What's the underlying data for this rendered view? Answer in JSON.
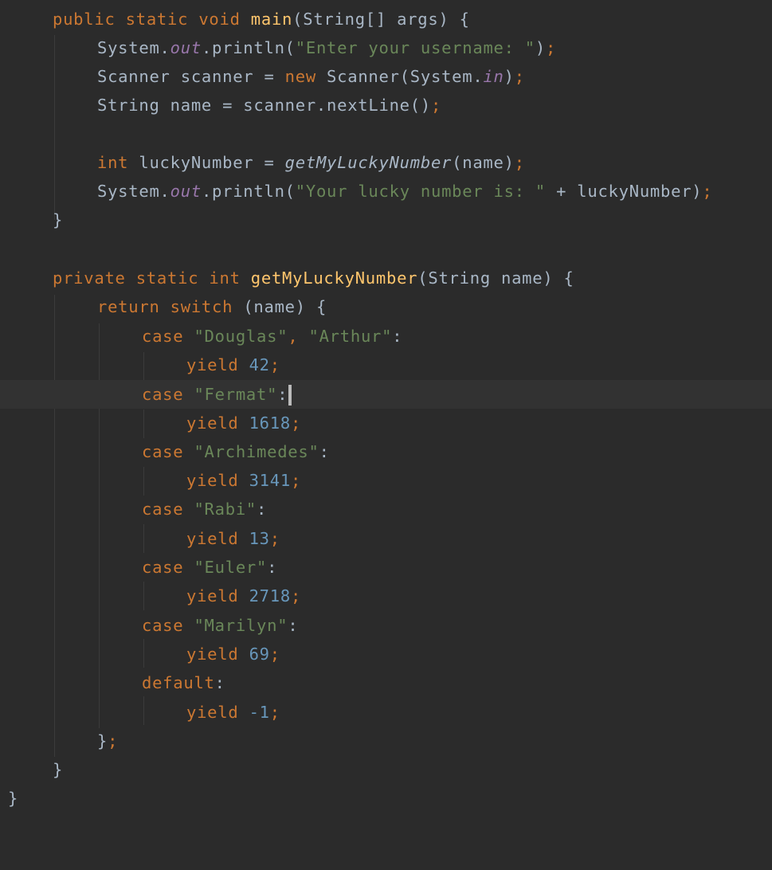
{
  "editor": {
    "language": "java",
    "colors": {
      "background": "#2b2b2b",
      "current_line": "#323232",
      "keyword": "#cc7832",
      "method_declaration": "#ffc66d",
      "string": "#6a8759",
      "number": "#6897bb",
      "static_field": "#9876aa",
      "default_text": "#a9b7c6"
    },
    "tokens": {
      "public": "public",
      "private": "private",
      "static": "static",
      "void": "void",
      "int": "int",
      "new": "new",
      "return": "return",
      "switch": "switch",
      "case": "case",
      "yield": "yield",
      "default": "default",
      "main": "main",
      "getMyLuckyNumber": "getMyLuckyNumber",
      "string_array_args": "(String[] args) {",
      "system": "System.",
      "out": "out",
      "in": "in",
      "println_open": ".println(",
      "str_enter": "\"Enter your username: \"",
      "str_lucky": "\"Your lucky number is: \"",
      "close_paren": ")",
      "semicolon": ";",
      "scanner_type": "Scanner scanner = ",
      "scanner_ctor": "Scanner(System.",
      "string_name_assign": "String name = scanner.nextLine()",
      "lucky_number_decl": "luckyNumber = ",
      "call_arg_name": "(name)",
      "plus_lucky": " + luckyNumber)",
      "close_brace": "}",
      "open_brace_sp": " {",
      "method_params": "(String name) {",
      "switch_subject": "(name) {",
      "str_douglas": "\"Douglas\"",
      "comma_sp": ", ",
      "str_arthur": "\"Arthur\"",
      "colon": ":",
      "str_fermat": "\"Fermat\"",
      "str_archimedes": "\"Archimedes\"",
      "str_rabi": "\"Rabi\"",
      "str_euler": "\"Euler\"",
      "str_marilyn": "\"Marilyn\"",
      "num_42": "42",
      "num_1618": "1618",
      "num_3141": "3141",
      "num_13": "13",
      "num_2718": "2718",
      "num_69": "69",
      "num_neg1": "-1"
    }
  }
}
